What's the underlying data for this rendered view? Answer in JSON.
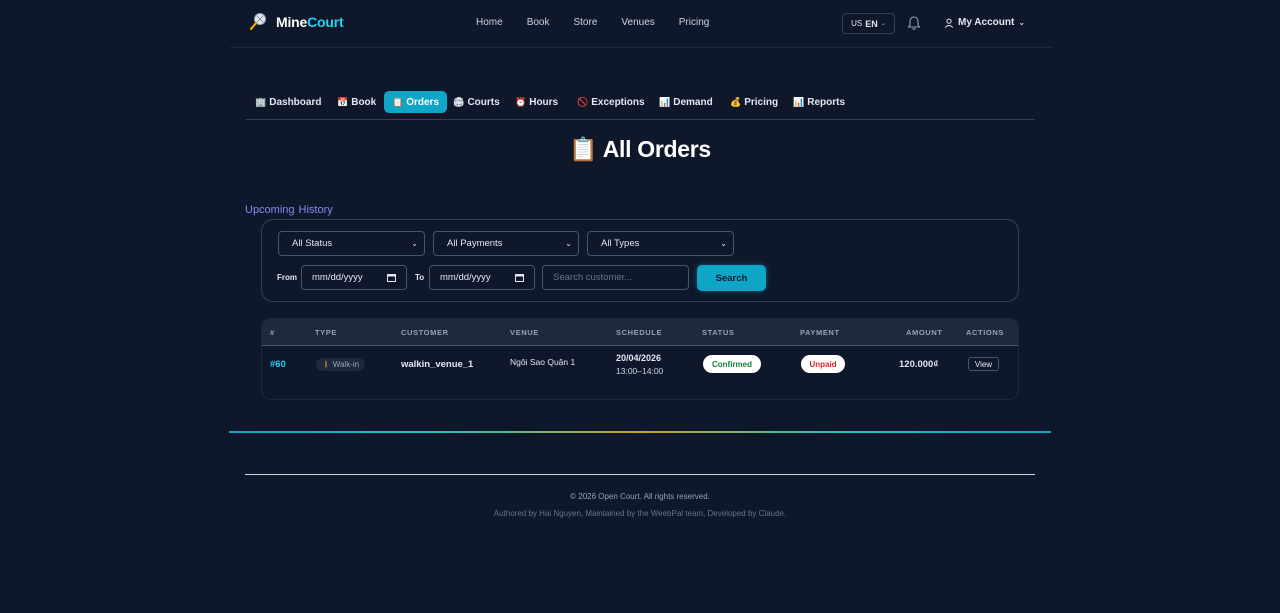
{
  "app": {
    "logo_part1": "Mine",
    "logo_part2": "Court"
  },
  "nav": {
    "items": [
      "Home",
      "Book",
      "Store",
      "Venues",
      "Pricing"
    ]
  },
  "header": {
    "lang_flag": "US",
    "lang_code": "EN",
    "account_label": "My Account"
  },
  "tabs": [
    {
      "icon": "🏢",
      "label": "Dashboard"
    },
    {
      "icon": "📅",
      "label": "Book"
    },
    {
      "icon": "📋",
      "label": "Orders"
    },
    {
      "icon": "🏟",
      "label": "Courts"
    },
    {
      "icon": "⏰",
      "label": "Hours"
    },
    {
      "icon": "🚫",
      "label": "Exceptions"
    },
    {
      "icon": "📊",
      "label": "Demand"
    },
    {
      "icon": "💰",
      "label": "Pricing"
    },
    {
      "icon": "📊",
      "label": "Reports"
    }
  ],
  "page": {
    "title_icon": "📋",
    "title": "All Orders"
  },
  "subtabs": {
    "upcoming": "Upcoming",
    "history": "History"
  },
  "filters": {
    "status": "All Status",
    "payments": "All Payments",
    "types": "All Types",
    "from_label": "From",
    "from_value": "mm/dd/yyyy",
    "to_label": "To",
    "to_value": "mm/dd/yyyy",
    "search_placeholder": "Search customer...",
    "search_button": "Search"
  },
  "table": {
    "columns": [
      "#",
      "TYPE",
      "CUSTOMER",
      "VENUE",
      "SCHEDULE",
      "STATUS",
      "PAYMENT",
      "AMOUNT",
      "ACTIONS"
    ],
    "rows": [
      {
        "id": "#60",
        "type_icon": "🚶",
        "type": "Walk-in",
        "customer": "walkin_venue_1",
        "venue": "Ngôi Sao Quận 1",
        "date": "20/04/2026",
        "time": "13:00–14:00",
        "status": "Confirmed",
        "payment": "Unpaid",
        "amount": "120.000₫",
        "action": "View"
      }
    ]
  },
  "footer": {
    "copyright": "© 2026 Open Court. All rights reserved.",
    "authored": "Authored by Hai Nguyen, Maintained by the WeebPal team, Developed by Claude."
  },
  "colors": {
    "background": "#0f172a",
    "accent": "#0ea5c6",
    "link": "#818cf8",
    "success": "#15803d",
    "danger": "#dc2626"
  }
}
